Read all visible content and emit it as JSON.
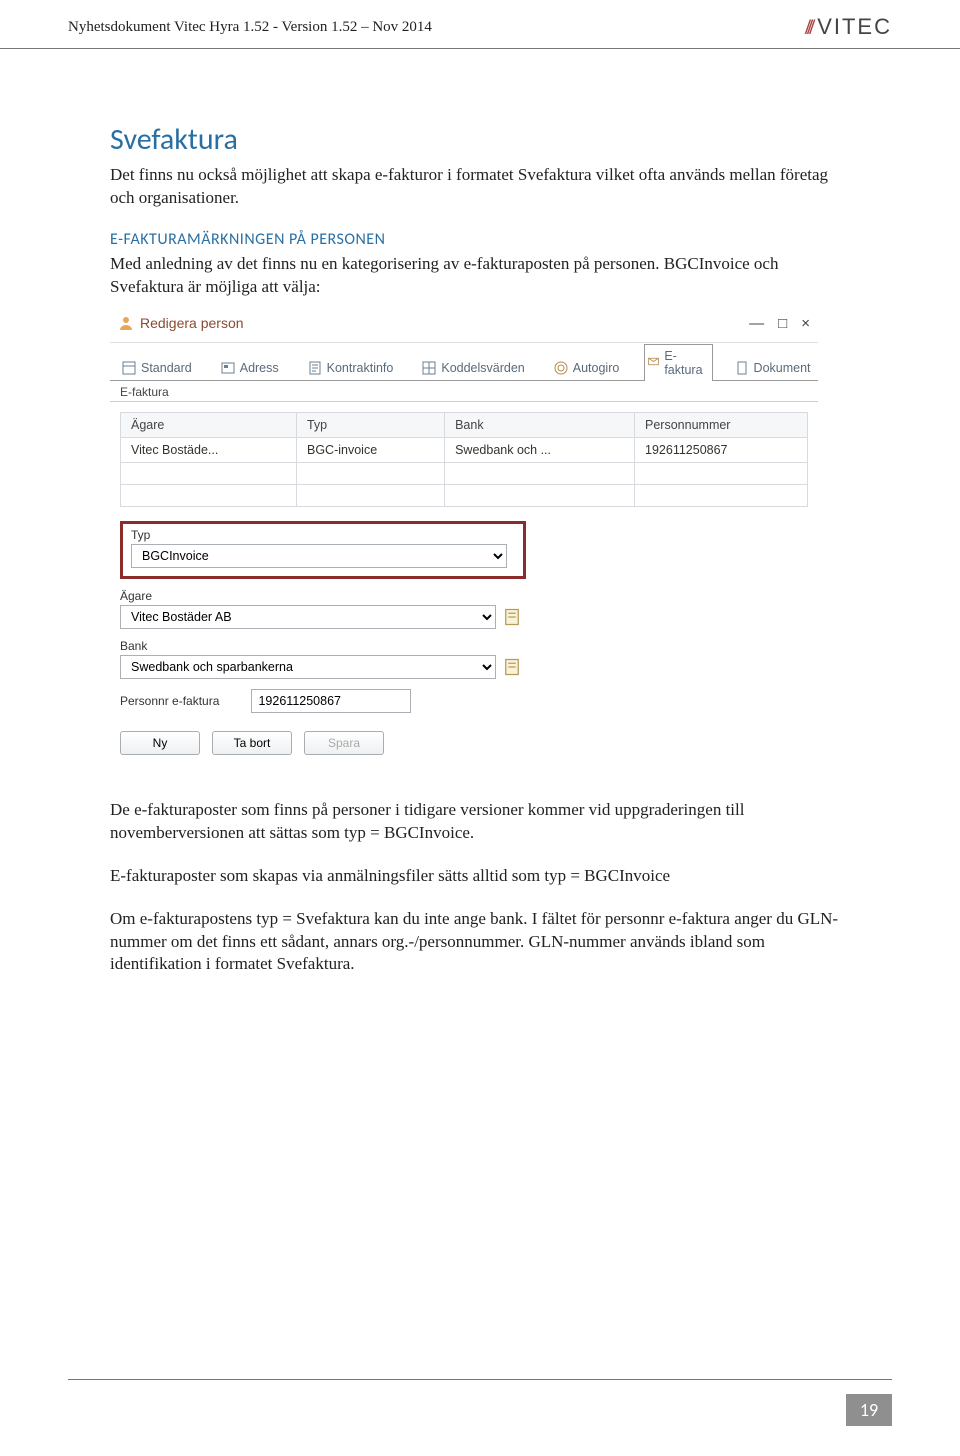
{
  "header": {
    "doc_title": "Nyhetsdokument Vitec Hyra 1.52 - Version 1.52 – Nov 2014",
    "brand": "VITEC"
  },
  "section": {
    "title": "Svefaktura",
    "intro": "Det finns nu också möjlighet att skapa e-fakturor i formatet Svefaktura vilket ofta används mellan företag och organisationer.",
    "sub_title": "E-FAKTURAMÄRKNINGEN PÅ PERSONEN",
    "sub_intro": "Med anledning av det finns nu en kategorisering av e-fakturaposten på personen. BGCInvoice och Svefaktura är möjliga att välja:"
  },
  "window": {
    "title": "Redigera person",
    "controls": {
      "min": "—",
      "max": "□",
      "close": "×"
    },
    "tabs": [
      {
        "label": "Standard"
      },
      {
        "label": "Adress"
      },
      {
        "label": "Kontraktinfo"
      },
      {
        "label": "Koddelsvärden"
      },
      {
        "label": "Autogiro"
      },
      {
        "label": "E-faktura",
        "active": true
      },
      {
        "label": "Dokument"
      }
    ],
    "group_label": "E-faktura",
    "grid": {
      "headers": [
        "Ägare",
        "Typ",
        "Bank",
        "Personnummer"
      ],
      "rows": [
        [
          "Vitec Bostäde...",
          "BGC-invoice",
          "Swedbank och ...",
          "192611250867"
        ],
        [
          "",
          "",
          "",
          ""
        ],
        [
          "",
          "",
          "",
          ""
        ]
      ]
    },
    "typ_label": "Typ",
    "typ_value": "BGCInvoice",
    "agare_label": "Ägare",
    "agare_value": "Vitec Bostäder AB",
    "bank_label": "Bank",
    "bank_value": "Swedbank och sparbankerna",
    "personnr_label": "Personnr e-faktura",
    "personnr_value": "192611250867",
    "btn_ny": "Ny",
    "btn_tabort": "Ta bort",
    "btn_spara": "Spara"
  },
  "after_screenshot": {
    "p1": "De e-fakturaposter som finns på personer i tidigare versioner kommer vid uppgraderingen till novemberversionen att sättas som typ = BGCInvoice.",
    "p2": "E-fakturaposter som skapas via anmälningsfiler sätts alltid som typ = BGCInvoice",
    "p3": "Om e-fakturapostens typ = Svefaktura kan du inte ange bank. I fältet för personnr e-faktura anger du GLN-nummer om det finns ett sådant, annars org.-/personnummer. GLN-nummer används ibland som identifikation i formatet Svefaktura."
  },
  "page_number": "19"
}
